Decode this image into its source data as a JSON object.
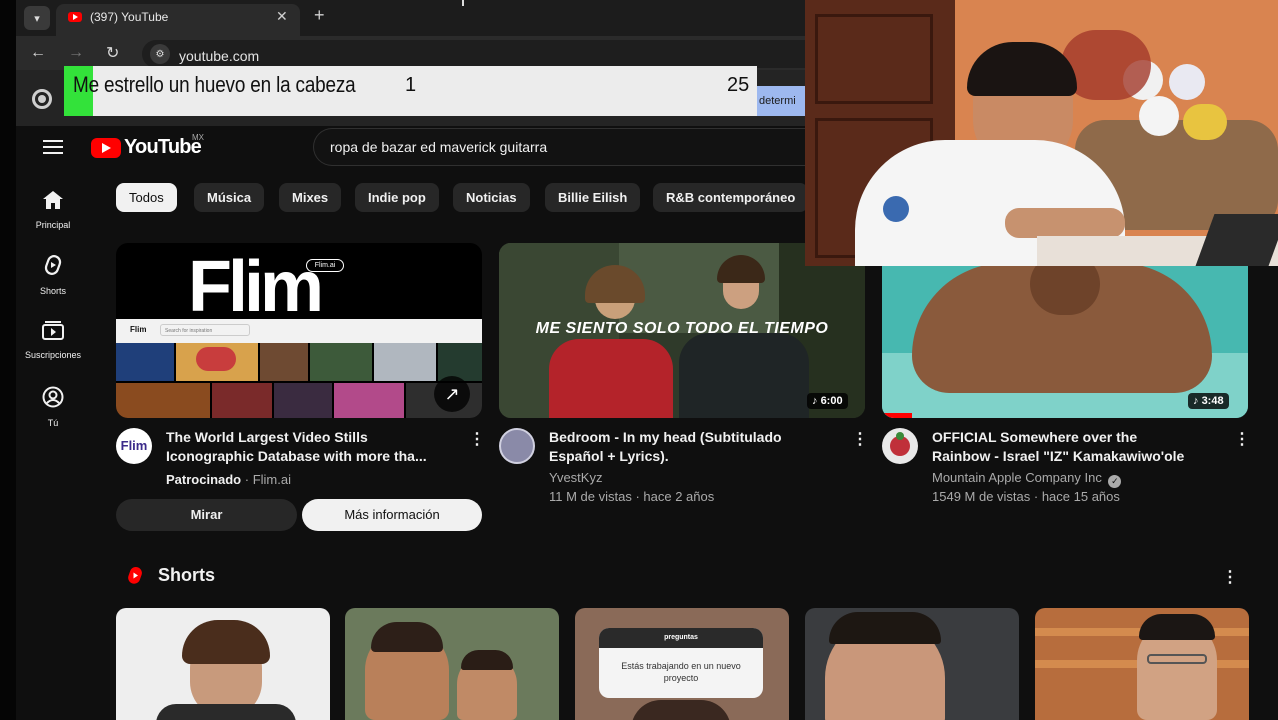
{
  "browser": {
    "tab_title": "(397) YouTube",
    "url": "youtube.com",
    "partial_chip": "determi",
    "icons": [
      "tab-list-icon",
      "close-icon",
      "plus-icon",
      "back-arrow-icon",
      "forward-arrow-icon",
      "reload-icon",
      "site-info-icon",
      "chrome-icon"
    ]
  },
  "overlay": {
    "text": "Me estrello un huevo en la cabeza",
    "count": "1",
    "total": "25"
  },
  "header": {
    "logo": "YouTube",
    "country": "MX",
    "search_value": "ropa de bazar ed maverick guitarra"
  },
  "sidebar": {
    "items": [
      {
        "label": "Principal",
        "icon": "home-icon"
      },
      {
        "label": "Shorts",
        "icon": "shorts-icon"
      },
      {
        "label": "Suscripciones",
        "icon": "subscriptions-icon"
      },
      {
        "label": "Tú",
        "icon": "account-icon"
      }
    ]
  },
  "chips": [
    "Todos",
    "Música",
    "Mixes",
    "Indie pop",
    "Noticias",
    "Billie Eilish",
    "R&B contemporáneo"
  ],
  "videos": [
    {
      "title_line1": "The World Largest Video Stills",
      "title_line2": "Iconographic Database with more tha...",
      "sponsor": "Patrocinado",
      "sponsor_site": "· Flim.ai",
      "thumb_brand": "Flim",
      "thumb_badge": "Flim.ai",
      "thumb_app_name": "Flim",
      "thumb_search": "Search for inspiration",
      "watch_label": "Mirar",
      "more_info_label": "Más información"
    },
    {
      "title_line1": "Bedroom - In my head (Subtitulado",
      "title_line2": "Español + Lyrics).",
      "channel": "YvestKyz",
      "stats": "11 M de vistas · hace 2 años",
      "overlay_text": "ME SIENTO SOLO TODO EL TIEMPO",
      "duration": "6:00"
    },
    {
      "title_line1": "OFFICIAL Somewhere over the",
      "title_line2": "Rainbow - Israel \"IZ\" Kamakawiwo'ole",
      "channel": "Mountain Apple Company Inc",
      "stats": "1549 M de vistas · hace 15 años",
      "duration": "3:48"
    }
  ],
  "shorts": {
    "heading": "Shorts",
    "card3_header": "preguntas",
    "card3_text": "Estás trabajando en un nuevo proyecto"
  },
  "colors": {
    "accent_red": "#ff0000",
    "overlay_green": "#33e23a",
    "background": "#0f0f0f"
  }
}
